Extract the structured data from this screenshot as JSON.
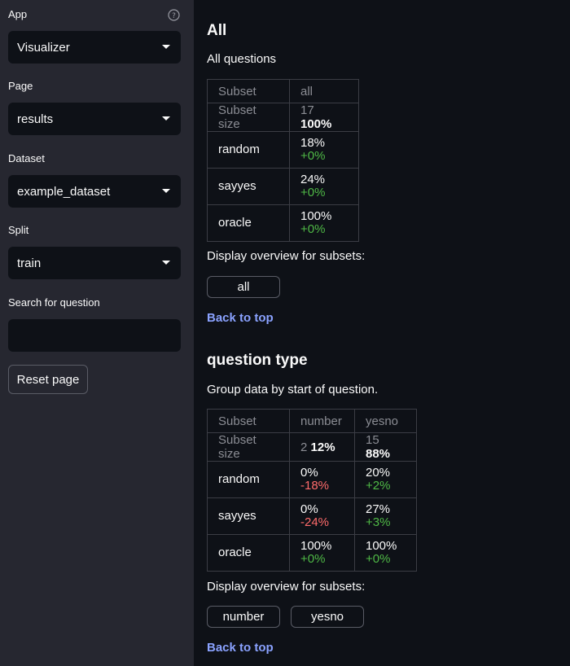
{
  "sidebar": {
    "app": {
      "label": "App",
      "value": "Visualizer"
    },
    "page": {
      "label": "Page",
      "value": "results"
    },
    "dataset": {
      "label": "Dataset",
      "value": "example_dataset"
    },
    "split": {
      "label": "Split",
      "value": "train"
    },
    "search": {
      "label": "Search for question",
      "value": "",
      "placeholder": ""
    },
    "reset_label": "Reset page",
    "help_icon": "question-circle-icon"
  },
  "sections": {
    "all": {
      "title": "All",
      "description": "All questions",
      "table": {
        "header_key": "Subset",
        "columns": [
          "all"
        ],
        "size_key": "Subset size",
        "sizes": [
          {
            "count": "17",
            "pct": "100%"
          }
        ],
        "rows": [
          {
            "name": "random",
            "cells": [
              {
                "value": "18%",
                "delta": "+0%"
              }
            ]
          },
          {
            "name": "sayyes",
            "cells": [
              {
                "value": "24%",
                "delta": "+0%"
              }
            ]
          },
          {
            "name": "oracle",
            "cells": [
              {
                "value": "100%",
                "delta": "+0%"
              }
            ]
          }
        ]
      },
      "overview_label": "Display overview for subsets:",
      "subset_buttons": [
        "all"
      ],
      "back_label": "Back to top"
    },
    "qtype": {
      "title": "question type",
      "description": "Group data by start of question.",
      "table": {
        "header_key": "Subset",
        "columns": [
          "number",
          "yesno"
        ],
        "size_key": "Subset size",
        "sizes": [
          {
            "count": "2",
            "pct": "12%"
          },
          {
            "count": "15",
            "pct": "88%"
          }
        ],
        "rows": [
          {
            "name": "random",
            "cells": [
              {
                "value": "0%",
                "delta": "-18%"
              },
              {
                "value": "20%",
                "delta": "+2%"
              }
            ]
          },
          {
            "name": "sayyes",
            "cells": [
              {
                "value": "0%",
                "delta": "-24%"
              },
              {
                "value": "27%",
                "delta": "+3%"
              }
            ]
          },
          {
            "name": "oracle",
            "cells": [
              {
                "value": "100%",
                "delta": "+0%"
              },
              {
                "value": "100%",
                "delta": "+0%"
              }
            ]
          }
        ]
      },
      "overview_label": "Display overview for subsets:",
      "subset_buttons": [
        "number",
        "yesno"
      ],
      "back_label": "Back to top"
    }
  },
  "colors": {
    "positive": "#4fb946",
    "negative": "#ff6b6b",
    "link": "#8aa2ff"
  }
}
